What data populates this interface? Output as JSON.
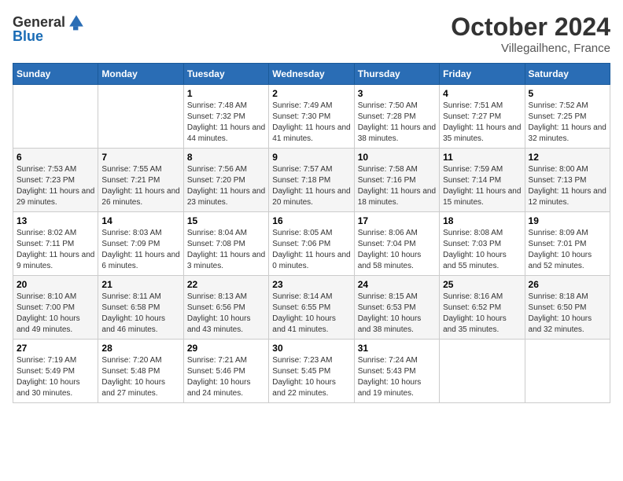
{
  "logo": {
    "text_general": "General",
    "text_blue": "Blue"
  },
  "title": "October 2024",
  "location": "Villegailhenc, France",
  "headers": [
    "Sunday",
    "Monday",
    "Tuesday",
    "Wednesday",
    "Thursday",
    "Friday",
    "Saturday"
  ],
  "weeks": [
    [
      {
        "day": "",
        "sunrise": "",
        "sunset": "",
        "daylight": ""
      },
      {
        "day": "",
        "sunrise": "",
        "sunset": "",
        "daylight": ""
      },
      {
        "day": "1",
        "sunrise": "Sunrise: 7:48 AM",
        "sunset": "Sunset: 7:32 PM",
        "daylight": "Daylight: 11 hours and 44 minutes."
      },
      {
        "day": "2",
        "sunrise": "Sunrise: 7:49 AM",
        "sunset": "Sunset: 7:30 PM",
        "daylight": "Daylight: 11 hours and 41 minutes."
      },
      {
        "day": "3",
        "sunrise": "Sunrise: 7:50 AM",
        "sunset": "Sunset: 7:28 PM",
        "daylight": "Daylight: 11 hours and 38 minutes."
      },
      {
        "day": "4",
        "sunrise": "Sunrise: 7:51 AM",
        "sunset": "Sunset: 7:27 PM",
        "daylight": "Daylight: 11 hours and 35 minutes."
      },
      {
        "day": "5",
        "sunrise": "Sunrise: 7:52 AM",
        "sunset": "Sunset: 7:25 PM",
        "daylight": "Daylight: 11 hours and 32 minutes."
      }
    ],
    [
      {
        "day": "6",
        "sunrise": "Sunrise: 7:53 AM",
        "sunset": "Sunset: 7:23 PM",
        "daylight": "Daylight: 11 hours and 29 minutes."
      },
      {
        "day": "7",
        "sunrise": "Sunrise: 7:55 AM",
        "sunset": "Sunset: 7:21 PM",
        "daylight": "Daylight: 11 hours and 26 minutes."
      },
      {
        "day": "8",
        "sunrise": "Sunrise: 7:56 AM",
        "sunset": "Sunset: 7:20 PM",
        "daylight": "Daylight: 11 hours and 23 minutes."
      },
      {
        "day": "9",
        "sunrise": "Sunrise: 7:57 AM",
        "sunset": "Sunset: 7:18 PM",
        "daylight": "Daylight: 11 hours and 20 minutes."
      },
      {
        "day": "10",
        "sunrise": "Sunrise: 7:58 AM",
        "sunset": "Sunset: 7:16 PM",
        "daylight": "Daylight: 11 hours and 18 minutes."
      },
      {
        "day": "11",
        "sunrise": "Sunrise: 7:59 AM",
        "sunset": "Sunset: 7:14 PM",
        "daylight": "Daylight: 11 hours and 15 minutes."
      },
      {
        "day": "12",
        "sunrise": "Sunrise: 8:00 AM",
        "sunset": "Sunset: 7:13 PM",
        "daylight": "Daylight: 11 hours and 12 minutes."
      }
    ],
    [
      {
        "day": "13",
        "sunrise": "Sunrise: 8:02 AM",
        "sunset": "Sunset: 7:11 PM",
        "daylight": "Daylight: 11 hours and 9 minutes."
      },
      {
        "day": "14",
        "sunrise": "Sunrise: 8:03 AM",
        "sunset": "Sunset: 7:09 PM",
        "daylight": "Daylight: 11 hours and 6 minutes."
      },
      {
        "day": "15",
        "sunrise": "Sunrise: 8:04 AM",
        "sunset": "Sunset: 7:08 PM",
        "daylight": "Daylight: 11 hours and 3 minutes."
      },
      {
        "day": "16",
        "sunrise": "Sunrise: 8:05 AM",
        "sunset": "Sunset: 7:06 PM",
        "daylight": "Daylight: 11 hours and 0 minutes."
      },
      {
        "day": "17",
        "sunrise": "Sunrise: 8:06 AM",
        "sunset": "Sunset: 7:04 PM",
        "daylight": "Daylight: 10 hours and 58 minutes."
      },
      {
        "day": "18",
        "sunrise": "Sunrise: 8:08 AM",
        "sunset": "Sunset: 7:03 PM",
        "daylight": "Daylight: 10 hours and 55 minutes."
      },
      {
        "day": "19",
        "sunrise": "Sunrise: 8:09 AM",
        "sunset": "Sunset: 7:01 PM",
        "daylight": "Daylight: 10 hours and 52 minutes."
      }
    ],
    [
      {
        "day": "20",
        "sunrise": "Sunrise: 8:10 AM",
        "sunset": "Sunset: 7:00 PM",
        "daylight": "Daylight: 10 hours and 49 minutes."
      },
      {
        "day": "21",
        "sunrise": "Sunrise: 8:11 AM",
        "sunset": "Sunset: 6:58 PM",
        "daylight": "Daylight: 10 hours and 46 minutes."
      },
      {
        "day": "22",
        "sunrise": "Sunrise: 8:13 AM",
        "sunset": "Sunset: 6:56 PM",
        "daylight": "Daylight: 10 hours and 43 minutes."
      },
      {
        "day": "23",
        "sunrise": "Sunrise: 8:14 AM",
        "sunset": "Sunset: 6:55 PM",
        "daylight": "Daylight: 10 hours and 41 minutes."
      },
      {
        "day": "24",
        "sunrise": "Sunrise: 8:15 AM",
        "sunset": "Sunset: 6:53 PM",
        "daylight": "Daylight: 10 hours and 38 minutes."
      },
      {
        "day": "25",
        "sunrise": "Sunrise: 8:16 AM",
        "sunset": "Sunset: 6:52 PM",
        "daylight": "Daylight: 10 hours and 35 minutes."
      },
      {
        "day": "26",
        "sunrise": "Sunrise: 8:18 AM",
        "sunset": "Sunset: 6:50 PM",
        "daylight": "Daylight: 10 hours and 32 minutes."
      }
    ],
    [
      {
        "day": "27",
        "sunrise": "Sunrise: 7:19 AM",
        "sunset": "Sunset: 5:49 PM",
        "daylight": "Daylight: 10 hours and 30 minutes."
      },
      {
        "day": "28",
        "sunrise": "Sunrise: 7:20 AM",
        "sunset": "Sunset: 5:48 PM",
        "daylight": "Daylight: 10 hours and 27 minutes."
      },
      {
        "day": "29",
        "sunrise": "Sunrise: 7:21 AM",
        "sunset": "Sunset: 5:46 PM",
        "daylight": "Daylight: 10 hours and 24 minutes."
      },
      {
        "day": "30",
        "sunrise": "Sunrise: 7:23 AM",
        "sunset": "Sunset: 5:45 PM",
        "daylight": "Daylight: 10 hours and 22 minutes."
      },
      {
        "day": "31",
        "sunrise": "Sunrise: 7:24 AM",
        "sunset": "Sunset: 5:43 PM",
        "daylight": "Daylight: 10 hours and 19 minutes."
      },
      {
        "day": "",
        "sunrise": "",
        "sunset": "",
        "daylight": ""
      },
      {
        "day": "",
        "sunrise": "",
        "sunset": "",
        "daylight": ""
      }
    ]
  ]
}
